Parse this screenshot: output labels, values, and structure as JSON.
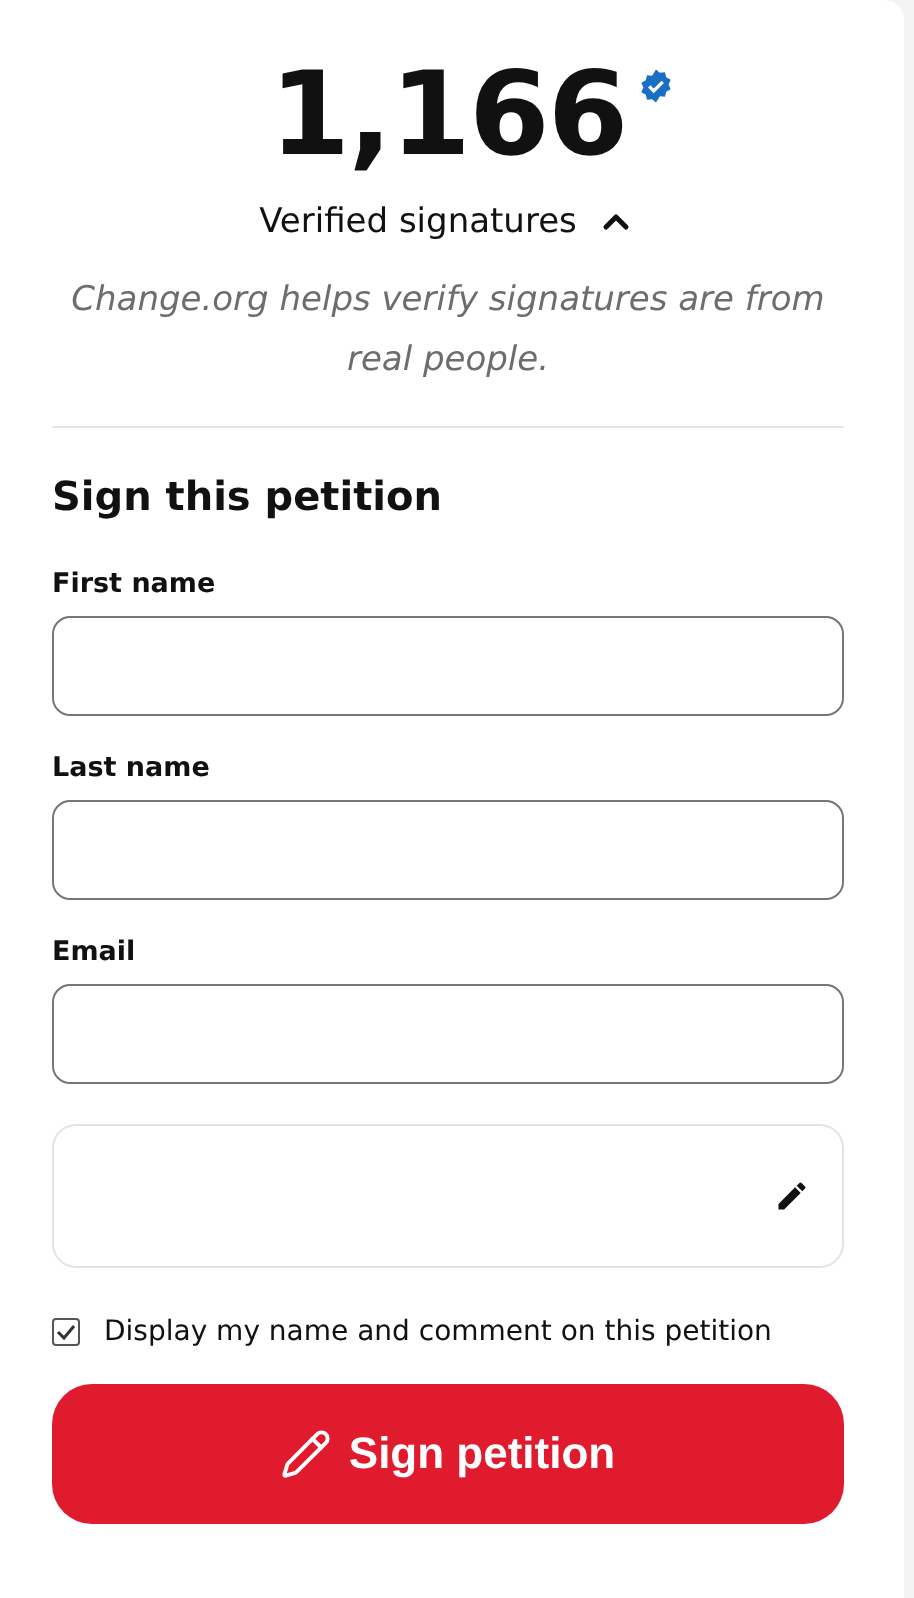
{
  "count": "1,166",
  "verified": {
    "label": "Verified signatures",
    "expanded": true
  },
  "note": "Change.org helps verify signatures are from real people.",
  "form": {
    "title": "Sign this petition",
    "fields": [
      {
        "label": "First name"
      },
      {
        "label": "Last name"
      },
      {
        "label": "Email"
      }
    ],
    "display_option": {
      "label": "Display my name and comment on this petition",
      "checked": true
    },
    "submit": "Sign petition"
  }
}
